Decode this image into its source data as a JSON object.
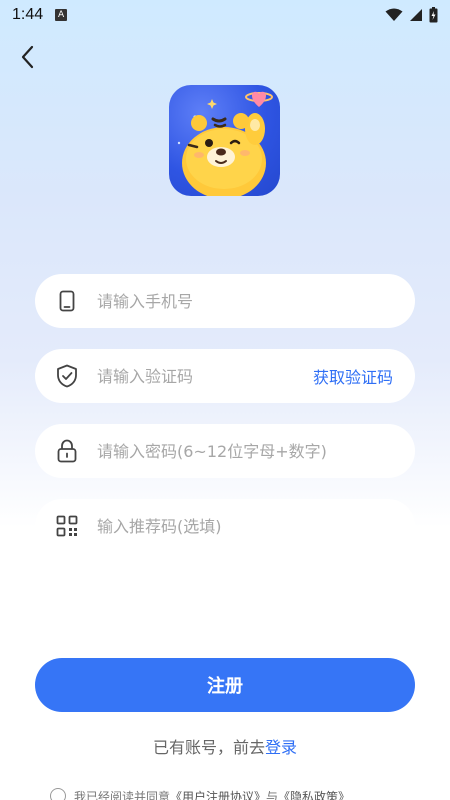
{
  "status_bar": {
    "time": "1:44",
    "notification_badge": "A"
  },
  "form": {
    "phone_placeholder": "请输入手机号",
    "code_placeholder": "请输入验证码",
    "get_code_label": "获取验证码",
    "password_placeholder": "请输入密码(6~12位字母+数字)",
    "referral_placeholder": "输入推荐码(选填)"
  },
  "register_button": "注册",
  "login_prompt": {
    "text": "已有账号，前去",
    "link": "登录"
  },
  "agreement": {
    "prefix": "我已经阅读并同意",
    "user_agreement": "《用户注册协议》",
    "conjunction": "与",
    "privacy_policy": "《隐私政策》"
  },
  "colors": {
    "accent": "#3675f6",
    "link": "#2f6ff5",
    "placeholder": "#a7a7a7"
  },
  "icons": [
    "back-arrow-icon",
    "phone-icon",
    "shield-check-icon",
    "lock-icon",
    "qr-code-icon",
    "wifi-icon",
    "signal-icon",
    "battery-icon"
  ]
}
